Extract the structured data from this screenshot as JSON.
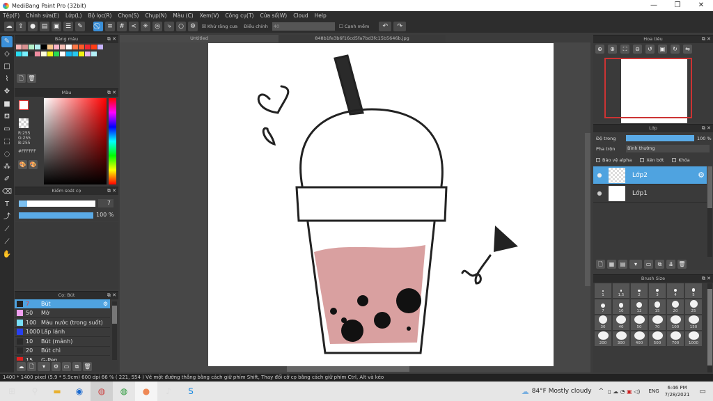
{
  "window": {
    "title": "MediBang Paint Pro (32bit)",
    "minimize": "—",
    "maximize": "❐",
    "close": "✕"
  },
  "menu": [
    "Tệp(F)",
    "Chỉnh sửa(E)",
    "Lớp(L)",
    "Bộ lọc(R)",
    "Chọn(S)",
    "Chụp(N)",
    "Màu (C)",
    "Xem(V)",
    "Công cụ(T)",
    "Cửa sổ(W)",
    "Cloud",
    "Help"
  ],
  "toolbar": {
    "antialias_label": "Khử răng cưa",
    "antialias_checked": true,
    "adjust_label": "Điều chỉnh",
    "adjust_value": "40",
    "soften_label": "Cạnh mềm",
    "soften_checked": false
  },
  "palette_panel": {
    "title": "Bảng màu",
    "swatches": [
      "#f7b4b4",
      "#d99090",
      "#b4f0c8",
      "#b4f0f0",
      "#000000",
      "#f7c88c",
      "#f7b4c8",
      "#f7beb4",
      "#ffffff",
      "#ff7846",
      "#ff5a28",
      "#f02832",
      "#ff3c14",
      "#c8b4ff",
      "#28dcf0",
      "#78f0ff",
      "#282828",
      "#f08ca0",
      "#ffffdc",
      "#f0f014",
      "#28dc50",
      "#ffffff",
      "#14b4f0",
      "#28c8f0",
      "#f0f014",
      "#e6b4f0",
      "#b4f0f8"
    ]
  },
  "color_panel": {
    "title": "Màu",
    "r": "R:255",
    "g": "G:255",
    "b": "B:255",
    "hex": "#FFFFFF",
    "base_color": "#ff0000"
  },
  "brush_control": {
    "title": "Kiểm soát cọ",
    "size": "7",
    "opacity": "100 %",
    "opacity_value": 100
  },
  "brush_panel": {
    "title": "Cọ: Bút",
    "items": [
      {
        "color": "#222222",
        "size": "7",
        "name": "Bút",
        "selected": true
      },
      {
        "color": "#f0a0f0",
        "size": "50",
        "name": "Mờ"
      },
      {
        "color": "#78e0f8",
        "size": "100",
        "name": "Màu nước (trong suốt)"
      },
      {
        "color": "#2840f0",
        "size": "1000",
        "name": "Lấp lánh"
      },
      {
        "color": "#2a2a2a",
        "size": "10",
        "name": "Bút (mảnh)"
      },
      {
        "color": "#2a2a2a",
        "size": "20",
        "name": "Bút chì"
      },
      {
        "color": "#e02020",
        "size": "15",
        "name": "G-Pen"
      }
    ]
  },
  "tabs": [
    "Untitled",
    "848b1fe3b6f16cd5fa7bd3fc15b5646b.jpg"
  ],
  "navigator": {
    "title": "Hoa tiêu"
  },
  "layers_panel": {
    "title": "Lớp",
    "opacity_label": "Độ trong",
    "opacity": "100 %",
    "opacity_value": 100,
    "blend_label": "Pha trộn",
    "blend_value": "Bình thường",
    "protect_alpha": "Bảo vệ alpha",
    "clipping": "Xén bớt",
    "lock": "Khóa",
    "layers": [
      {
        "name": "Lớp2",
        "selected": true
      },
      {
        "name": "Lớp1",
        "selected": false
      }
    ]
  },
  "brush_size": {
    "title": "Brush Size",
    "sizes": [
      "1",
      "1.5",
      "2",
      "3",
      "4",
      "5",
      "7",
      "10",
      "12",
      "15",
      "20",
      "25",
      "30",
      "40",
      "50",
      "70",
      "100",
      "150",
      "200",
      "300",
      "400",
      "500",
      "700",
      "1000"
    ]
  },
  "status": {
    "text": "1400 * 1400 pixel   (5.9 * 5.9cm)   600 dpi   66 %   ( 221, 554 )   Vẽ một đường thẳng bằng cách giữ phím Shift, Thay đổi cỡ cọ bằng cách giữ phím Ctrl, Alt và kéo"
  },
  "taskbar": {
    "weather": "84°F  Mostly cloudy",
    "lang": "ENG",
    "time": "6:46 PM",
    "date": "7/28/2021"
  }
}
